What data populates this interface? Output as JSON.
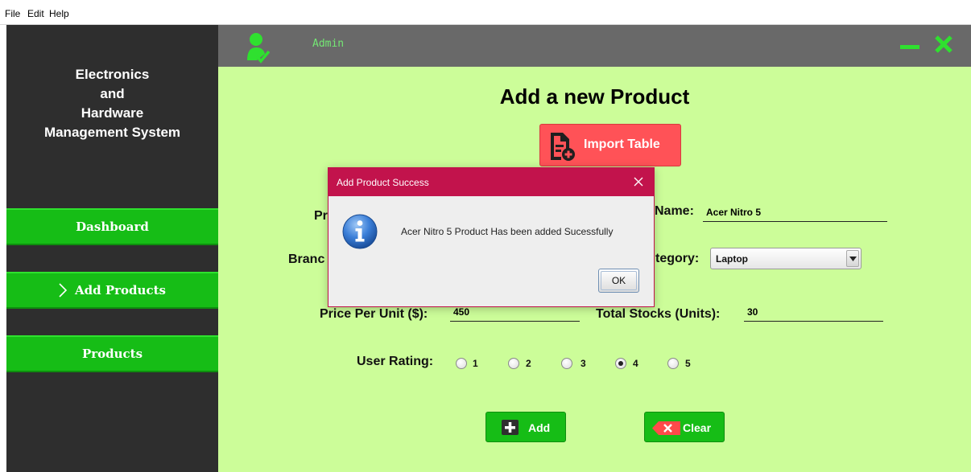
{
  "menubar": {
    "items": [
      "File",
      "Edit",
      "Help"
    ]
  },
  "sidebar": {
    "title_lines": [
      "Electronics",
      "and",
      "Hardware",
      "Management System"
    ],
    "nav": [
      {
        "label": "Dashboard"
      },
      {
        "label": "Add Products",
        "active": true
      },
      {
        "label": "Products"
      }
    ]
  },
  "header": {
    "user": "Admin"
  },
  "form": {
    "title": "Add a new Product",
    "import_label": "Import Table",
    "product_id_label_visible": "Pr",
    "product_name_label_visible": "Name:",
    "product_name_value": "Acer Nitro 5",
    "brand_label_visible": "Branc",
    "category_label_visible": "tegory:",
    "category_value": "Laptop",
    "price_label": "Price Per Unit ($):",
    "price_value": "450",
    "stocks_label": "Total Stocks (Units):",
    "stocks_value": "30",
    "rating_label": "User Rating:",
    "rating_options": [
      "1",
      "2",
      "3",
      "4",
      "5"
    ],
    "rating_selected": "4",
    "add_label": "Add",
    "clear_label": "Clear"
  },
  "dialog": {
    "title": "Add Product Success",
    "message": "Acer Nitro 5 Product Has been added Sucessfully",
    "ok_label": "OK"
  },
  "colors": {
    "sidebar_bg": "#2e2e2e",
    "nav_green": "#16bd16",
    "header_bg": "#696969",
    "main_bg": "#ccfd99",
    "import_red": "#ff5257",
    "dialog_titlebar": "#c2134c",
    "accent_green": "#2fe02f"
  },
  "icons": {
    "user": "user-check-icon",
    "minimize": "minimize-icon",
    "close": "close-icon",
    "import": "document-add-icon",
    "info": "info-icon",
    "add": "plus-icon",
    "clear": "delete-x-icon",
    "chevron": "chevron-right-icon"
  }
}
